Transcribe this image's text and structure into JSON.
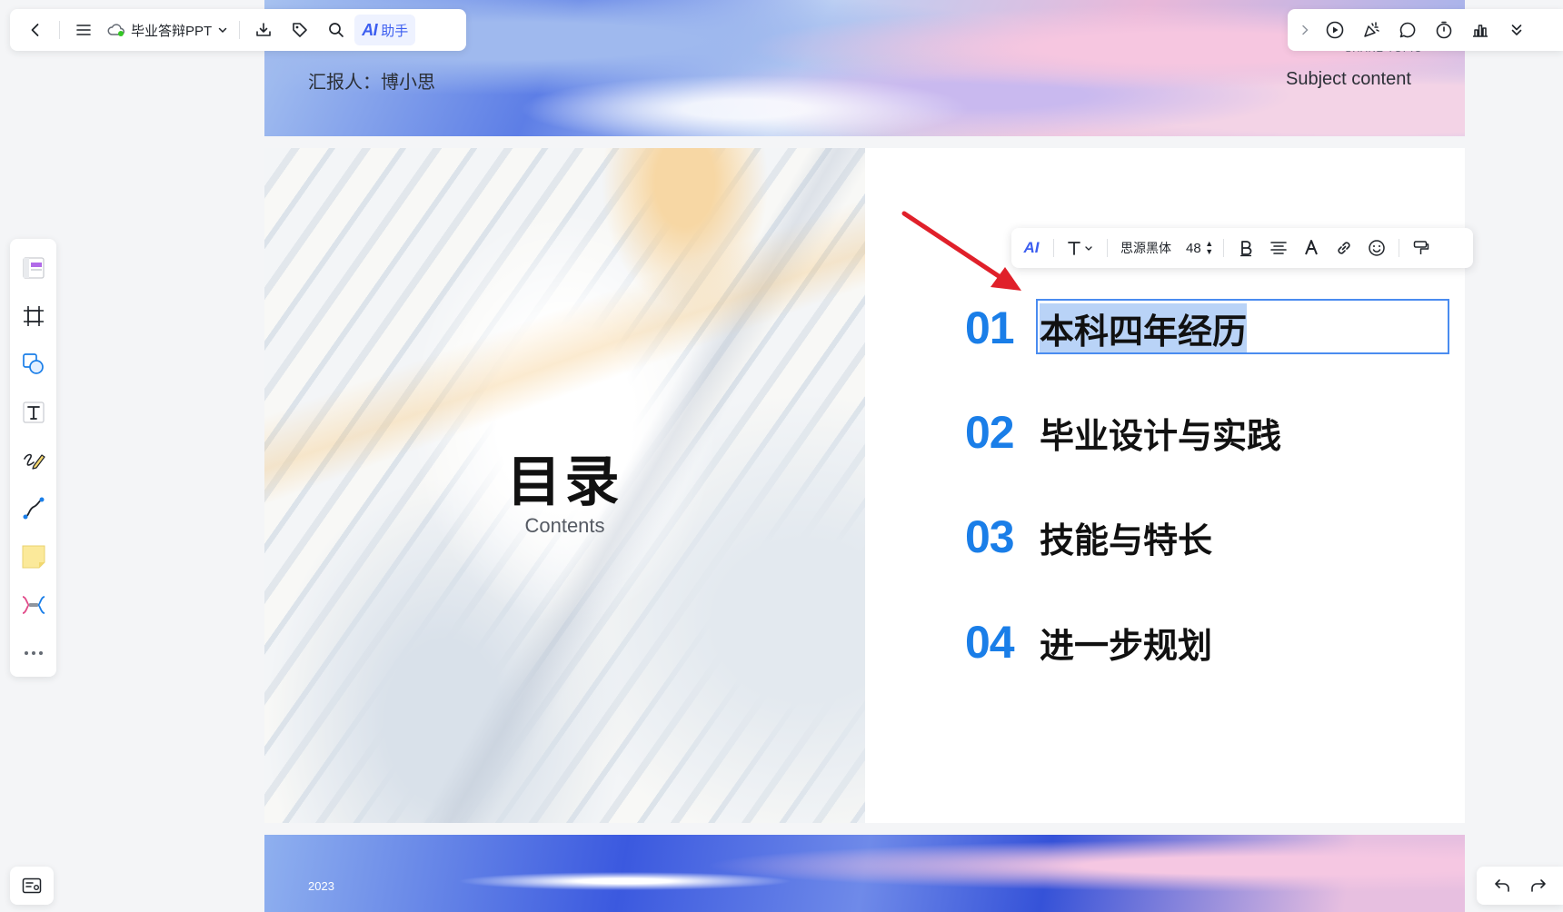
{
  "topbar": {
    "doc_title": "毕业答辩PPT",
    "ai_label": "AI",
    "ai_assistant": "助手"
  },
  "slides": {
    "top": {
      "reporter": "汇报人：博小思",
      "share_topic": "SHARE TOPIC",
      "subject": "Subject content"
    },
    "toc": {
      "title": "目录",
      "subtitle": "Contents",
      "items": [
        {
          "num": "01",
          "text": "本科四年经历"
        },
        {
          "num": "02",
          "text": "毕业设计与实践"
        },
        {
          "num": "03",
          "text": "技能与特长"
        },
        {
          "num": "04",
          "text": "进一步规划"
        }
      ]
    },
    "bottom": {
      "year": "2023"
    }
  },
  "format_toolbar": {
    "ai_label": "AI",
    "font_name": "思源黑体",
    "font_size": "48"
  },
  "colors": {
    "accent": "#3c5ef0",
    "number_blue": "#1a7ee8",
    "selection": "#b9d3f7",
    "annotation_arrow": "#e0202a"
  }
}
